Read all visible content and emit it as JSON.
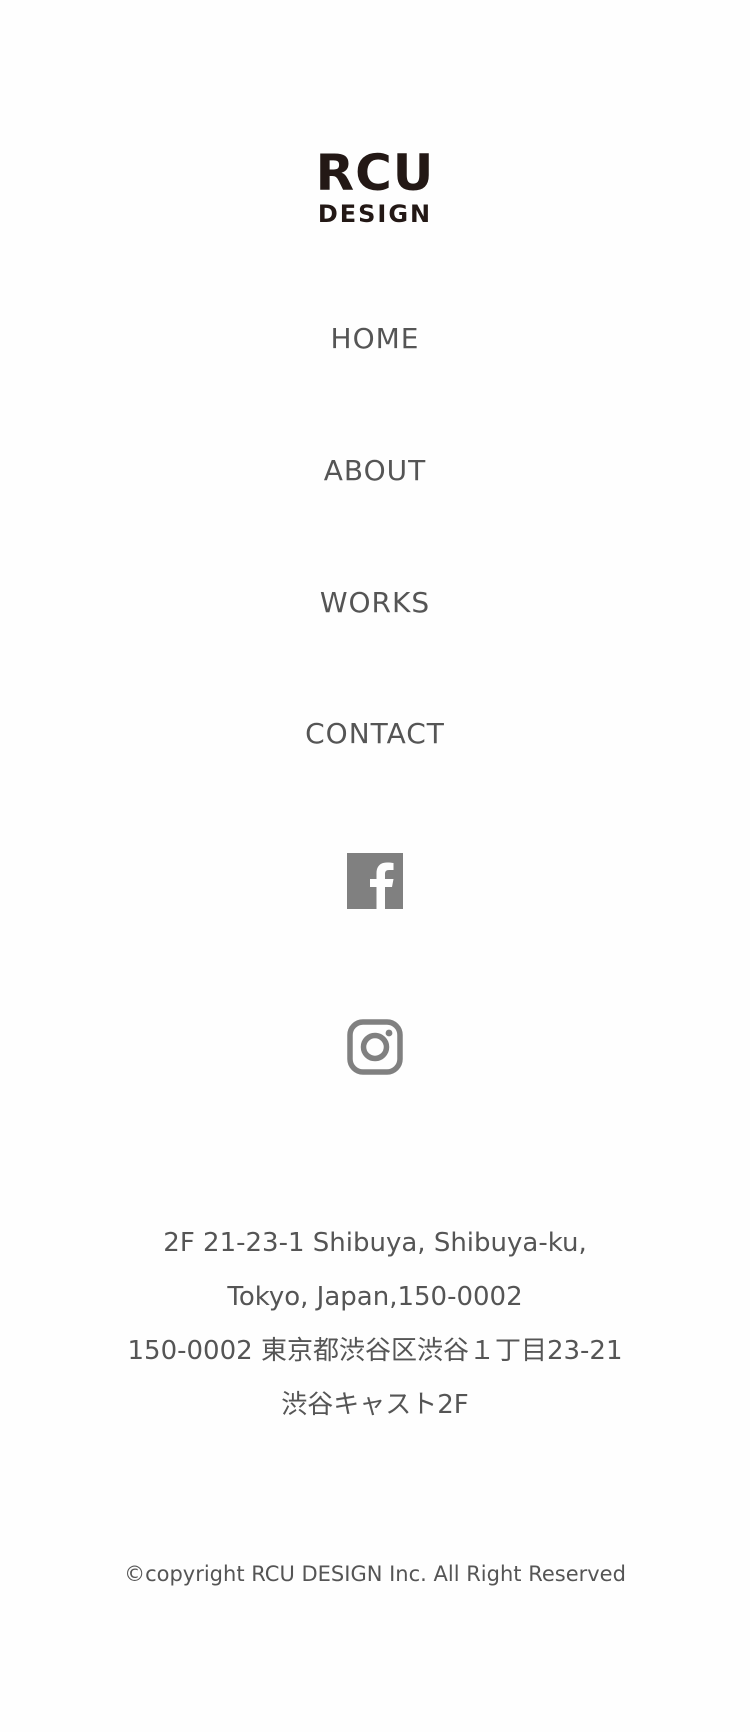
{
  "logo": {
    "line1": "RCU",
    "line2": "DESIGN"
  },
  "nav": {
    "home": "HOME",
    "about": "ABOUT",
    "works": "WORKS",
    "contact": "CONTACT"
  },
  "social": {
    "facebook_icon": "facebook-icon",
    "instagram_icon": "instagram-icon"
  },
  "address": {
    "line1": "2F 21-23-1 Shibuya, Shibuya-ku,",
    "line2": "Tokyo, Japan,150-0002",
    "line3": "150-0002 東京都渋谷区渋谷１丁目23-21",
    "line4": "渋谷キャスト2F"
  },
  "footer": {
    "copyright": "©copyright RCU DESIGN Inc. All Right Reserved"
  },
  "colors": {
    "logo": "#231815",
    "text": "#555555",
    "icon": "#808080",
    "background": "#fefefe"
  }
}
